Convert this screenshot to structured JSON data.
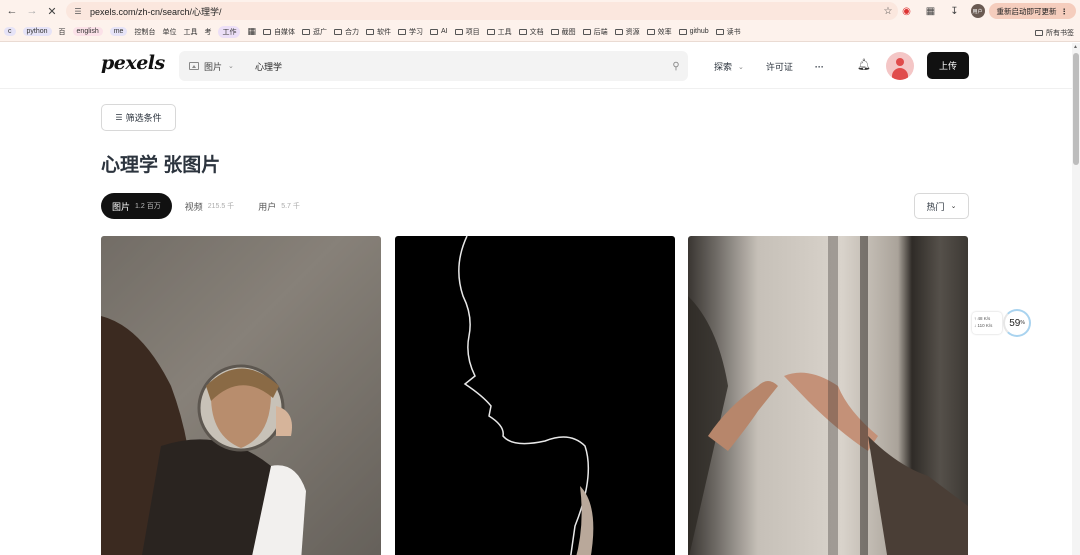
{
  "browser": {
    "url": "pexels.com/zh-cn/search/心理学/",
    "update_label": "重新启动即可更新",
    "profile_initials": "用户",
    "bookmarks": [
      {
        "label": "c",
        "style": "pill"
      },
      {
        "label": "python",
        "style": "pill"
      },
      {
        "label": "百",
        "style": "plain"
      },
      {
        "label": "english",
        "style": "pink"
      },
      {
        "label": "me",
        "style": "pill"
      },
      {
        "label": "控制台",
        "style": "plain"
      },
      {
        "label": "单位",
        "style": "plain"
      },
      {
        "label": "工具",
        "style": "plain"
      },
      {
        "label": "考",
        "style": "plain"
      },
      {
        "label": "工作",
        "style": "purple"
      },
      {
        "label": "",
        "style": "grid"
      },
      {
        "label": "自媒体",
        "style": "folder"
      },
      {
        "label": "逛广",
        "style": "folder"
      },
      {
        "label": "合力",
        "style": "folder"
      },
      {
        "label": "软件",
        "style": "folder"
      },
      {
        "label": "学习",
        "style": "folder"
      },
      {
        "label": "AI",
        "style": "folder"
      },
      {
        "label": "项目",
        "style": "folder"
      },
      {
        "label": "工具",
        "style": "folder"
      },
      {
        "label": "文档",
        "style": "folder"
      },
      {
        "label": "截图",
        "style": "folder"
      },
      {
        "label": "后端",
        "style": "folder"
      },
      {
        "label": "资源",
        "style": "folder"
      },
      {
        "label": "效率",
        "style": "folder"
      },
      {
        "label": "github",
        "style": "folder"
      },
      {
        "label": "读书",
        "style": "folder"
      }
    ],
    "all_bookmarks_label": "所有书签"
  },
  "header": {
    "logo": "pexels",
    "search_type": "图片",
    "search_query": "心理学",
    "nav_explore": "探索",
    "nav_license": "许可证",
    "nav_more": "···",
    "upload_label": "上传"
  },
  "content": {
    "filter_label": "筛选条件",
    "title": "心理学 张图片",
    "tabs": [
      {
        "label": "图片",
        "count": "1.2 百万"
      },
      {
        "label": "视频",
        "count": "215.5 千"
      },
      {
        "label": "用户",
        "count": "5.7 千"
      }
    ],
    "sort_label": "热门"
  },
  "net_widget": {
    "up": "↑ 48  K/s",
    "down": "↓ 110 K/s",
    "percent": "59",
    "percent_unit": "%"
  }
}
